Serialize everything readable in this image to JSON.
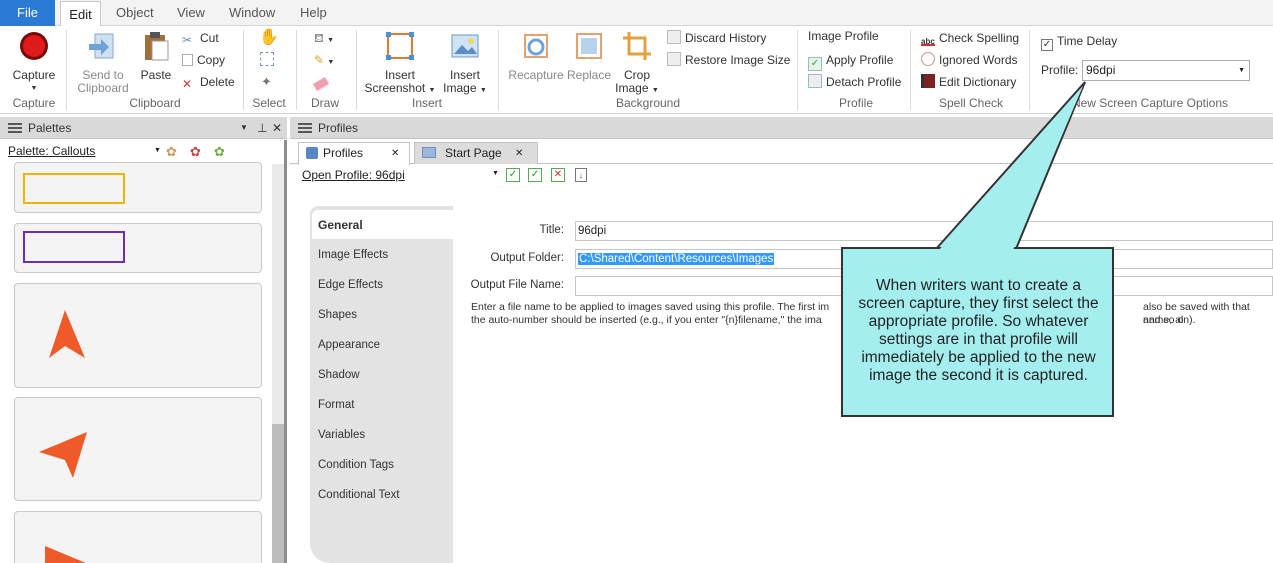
{
  "menubar": {
    "items": [
      "File",
      "Edit",
      "Object",
      "View",
      "Window",
      "Help"
    ]
  },
  "ribbon": {
    "capture": {
      "label": "Capture",
      "group": "Capture"
    },
    "clipboard": {
      "send_label1": "Send to",
      "send_label2": "Clipboard",
      "paste": "Paste",
      "cut": "Cut",
      "copy": "Copy",
      "delete": "Delete",
      "group": "Clipboard"
    },
    "select": {
      "group": "Select"
    },
    "draw": {
      "group": "Draw"
    },
    "insert": {
      "screenshot1": "Insert",
      "screenshot2": "Screenshot",
      "image1": "Insert",
      "image2": "Image",
      "group": "Insert"
    },
    "background": {
      "recapture": "Recapture",
      "replace": "Replace",
      "crop1": "Crop",
      "crop2": "Image",
      "discard_history": "Discard History",
      "restore_size": "Restore Image Size",
      "group": "Background"
    },
    "profile": {
      "image_profile": "Image Profile",
      "apply": "Apply Profile",
      "detach": "Detach Profile",
      "group": "Profile"
    },
    "spell": {
      "check": "Check Spelling",
      "ignored": "Ignored Words",
      "dictionary": "Edit Dictionary",
      "group": "Spell Check"
    },
    "newcapture": {
      "time_delay": "Time Delay",
      "profile_label": "Profile:",
      "profile_value": "96dpi",
      "group": "New Screen Capture Options"
    }
  },
  "palettes": {
    "title": "Palettes",
    "palette_label": "Palette: Callouts"
  },
  "profiles": {
    "title": "Profiles",
    "tabs": [
      {
        "label": "Profiles"
      },
      {
        "label": "Start Page"
      }
    ],
    "open_profile": "Open Profile: 96dpi",
    "nav": [
      "General",
      "Image Effects",
      "Edge Effects",
      "Shapes",
      "Appearance",
      "Shadow",
      "Format",
      "Variables",
      "Condition Tags",
      "Conditional Text"
    ],
    "form": {
      "title_label": "Title:",
      "title_value": "96dpi",
      "folder_label": "Output Folder:",
      "folder_value": "C:\\Shared\\Content\\Resources\\Images",
      "filename_label": "Output File Name:",
      "filename_value": "",
      "help_line1": "Enter a file name to be applied to images saved using this profile. The first im",
      "help_line1b": "also be saved with that name, al",
      "help_line2": "the auto-number should be inserted (e.g., if you enter \"{n}filename,\" the ima",
      "help_line2b": "and so on)."
    }
  },
  "callout": {
    "text": "When writers want to create a screen capture, they first select the appropriate profile. So whatever settings are in that profile will immediately be applied to the new image the second it is captured."
  },
  "colors": {
    "file_tab": "#2b7bd6",
    "callout_fill": "#a5eef0",
    "selection": "#3399ff"
  }
}
